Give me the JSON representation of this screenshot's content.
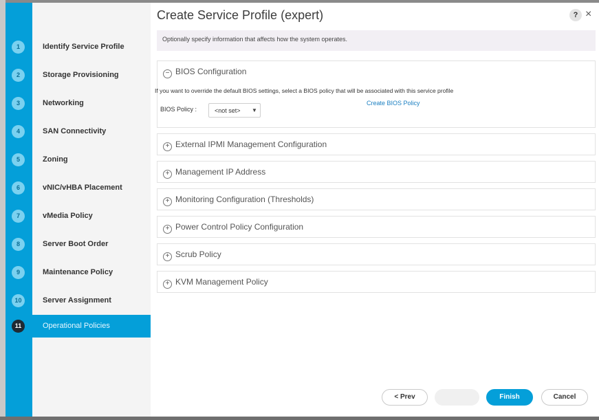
{
  "dialog": {
    "title": "Create Service Profile (expert)",
    "help_label": "?",
    "close_label": "×",
    "info_text": "Optionally specify information that affects how the system operates."
  },
  "steps": [
    {
      "number": "1",
      "label": "Identify Service Profile"
    },
    {
      "number": "2",
      "label": "Storage Provisioning"
    },
    {
      "number": "3",
      "label": "Networking"
    },
    {
      "number": "4",
      "label": "SAN Connectivity"
    },
    {
      "number": "5",
      "label": "Zoning"
    },
    {
      "number": "6",
      "label": "vNIC/vHBA Placement"
    },
    {
      "number": "7",
      "label": "vMedia Policy"
    },
    {
      "number": "8",
      "label": "Server Boot Order"
    },
    {
      "number": "9",
      "label": "Maintenance Policy"
    },
    {
      "number": "10",
      "label": "Server Assignment"
    },
    {
      "number": "11",
      "label": "Operational Policies",
      "active": true
    }
  ],
  "sections": {
    "bios": {
      "toggle": "−",
      "title": "BIOS Configuration",
      "description": "If you want to override the default BIOS settings, select a BIOS policy that will be associated with this service profile",
      "create_link": "Create BIOS Policy",
      "policy_label": "BIOS Policy :",
      "policy_value": "<not set>",
      "chevron": "▼"
    },
    "collapsed": [
      {
        "toggle": "+",
        "title": "External IPMI Management Configuration"
      },
      {
        "toggle": "+",
        "title": "Management IP Address"
      },
      {
        "toggle": "+",
        "title": "Monitoring Configuration (Thresholds)"
      },
      {
        "toggle": "+",
        "title": "Power Control Policy Configuration"
      },
      {
        "toggle": "+",
        "title": "Scrub Policy"
      },
      {
        "toggle": "+",
        "title": "KVM Management Policy"
      }
    ]
  },
  "footer": {
    "prev_label": "< Prev",
    "finish_label": "Finish",
    "cancel_label": "Cancel"
  },
  "colors": {
    "accent": "#049fd9",
    "active_step_circle": "#1f2a33",
    "link": "#1a7fc1"
  }
}
